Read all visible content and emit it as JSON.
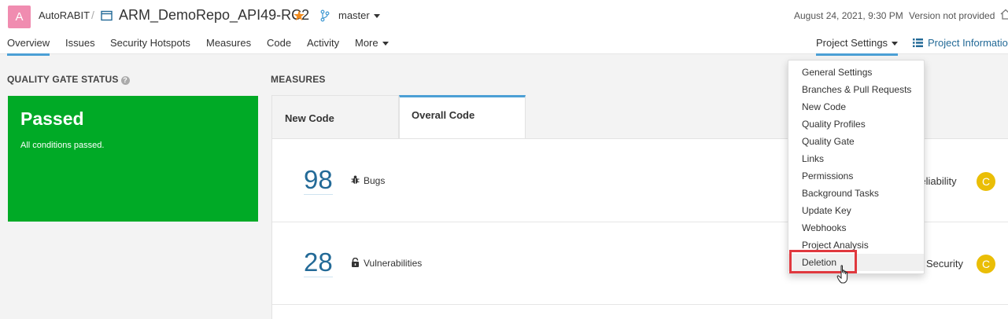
{
  "header": {
    "avatar_letter": "A",
    "org": "AutoRABIT",
    "separator": "/",
    "project": "ARM_DemoRepo_API49-RC2",
    "branch": "master",
    "date": "August 24, 2021, 9:30 PM",
    "version": "Version not provided"
  },
  "nav": {
    "items": [
      "Overview",
      "Issues",
      "Security Hotspots",
      "Measures",
      "Code",
      "Activity",
      "More"
    ],
    "project_settings": "Project Settings",
    "project_info": "Project Informatio"
  },
  "quality_gate": {
    "title": "QUALITY GATE STATUS",
    "status": "Passed",
    "message": "All conditions passed."
  },
  "measures": {
    "title": "MEASURES",
    "tabs": [
      "New Code",
      "Overall Code"
    ],
    "rows": [
      {
        "value": "98",
        "label": "Bugs",
        "rating_label": "Reliability",
        "rating": "C"
      },
      {
        "value": "28",
        "label": "Vulnerabilities",
        "rating_label": "Security",
        "rating": "C"
      }
    ]
  },
  "settings_menu": {
    "items": [
      "General Settings",
      "Branches & Pull Requests",
      "New Code",
      "Quality Profiles",
      "Quality Gate",
      "Links",
      "Permissions",
      "Background Tasks",
      "Update Key",
      "Webhooks",
      "Project Analysis",
      "Deletion"
    ],
    "hovered": "Deletion"
  },
  "colors": {
    "passed_green": "#00aa26",
    "link_blue": "#236a97",
    "accent_blue": "#4b9fd5",
    "rating_c": "#eabe06",
    "highlight_red": "#e0383e"
  }
}
